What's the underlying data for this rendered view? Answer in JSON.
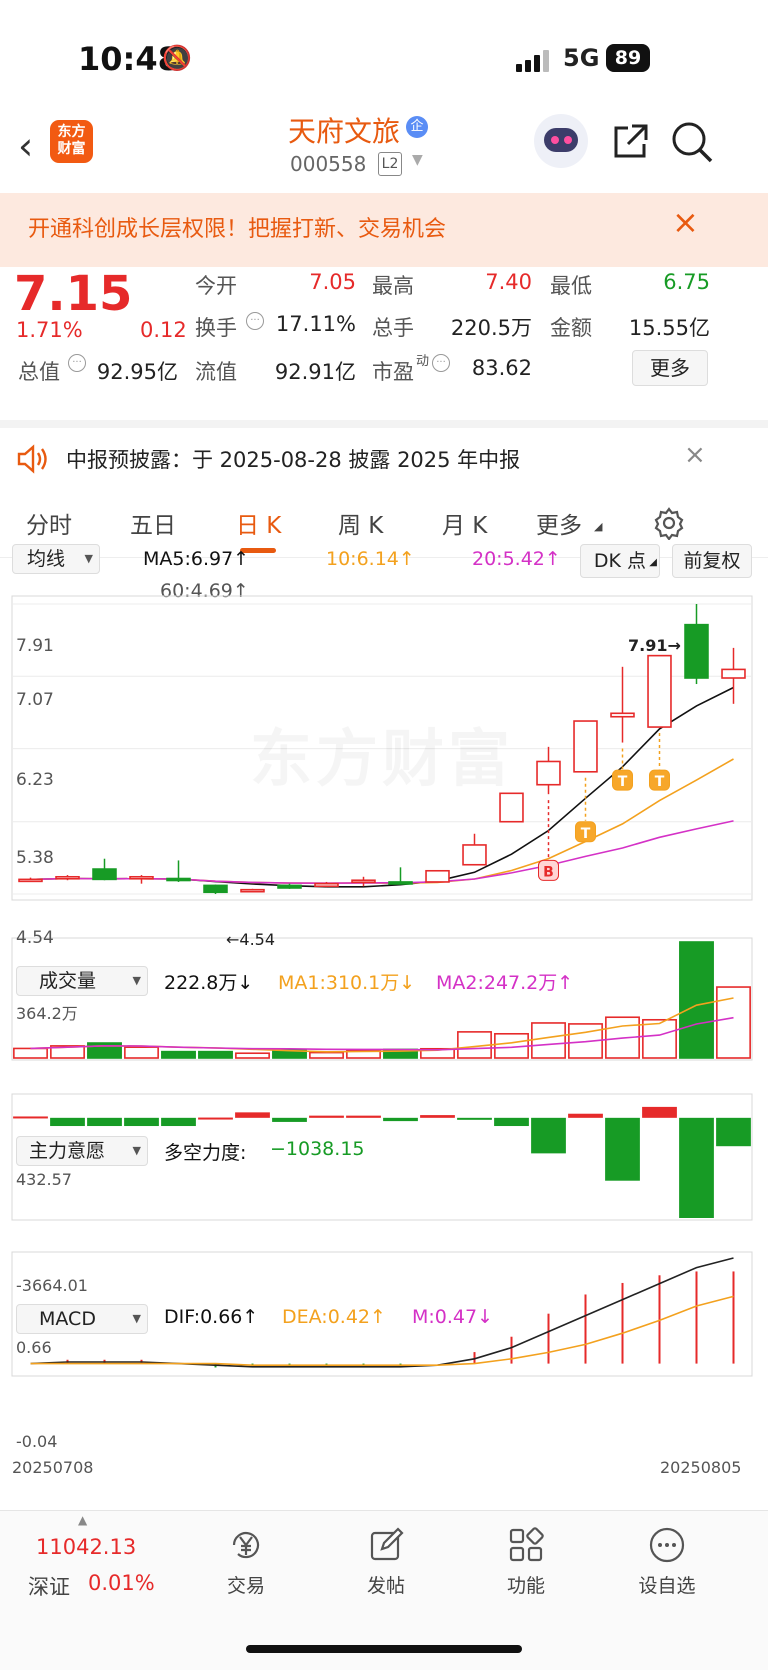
{
  "status": {
    "time": "10:48",
    "network": "5G",
    "battery": "89"
  },
  "nav": {
    "stock_name": "天府文旅",
    "badge": "企",
    "stock_code": "000558",
    "level": "L2",
    "logo_line1": "东方",
    "logo_line2": "财富"
  },
  "banner": {
    "text": "开通科创成长层权限！把握打新、交易机会"
  },
  "quote": {
    "price": "7.15",
    "change_pct": "1.71%",
    "change_amt": "0.12",
    "open_label": "今开",
    "open": "7.05",
    "high_label": "最高",
    "high": "7.40",
    "low_label": "最低",
    "low": "6.75",
    "turnover_label": "换手",
    "turnover": "17.11%",
    "volume_label": "总手",
    "volume": "220.5万",
    "amount_label": "金额",
    "amount": "15.55亿",
    "mktcap_label": "总值",
    "mktcap": "92.95亿",
    "float_label": "流值",
    "float": "92.91亿",
    "pe_label": "市盈",
    "pe_sup": "动",
    "pe": "83.62",
    "more": "更多"
  },
  "notice": {
    "text": "中报预披露：于 2025-08-28 披露 2025 年中报"
  },
  "tabs": [
    {
      "label": "分时"
    },
    {
      "label": "五日"
    },
    {
      "label": "日 K"
    },
    {
      "label": "周 K"
    },
    {
      "label": "月 K"
    },
    {
      "label": "更多"
    }
  ],
  "kline": {
    "indicator": "均线",
    "ma5": "MA5:6.97↑",
    "ma10": "10:6.14↑",
    "ma20": "20:5.42↑",
    "ma60": "60:4.69↑",
    "dk": "DK 点",
    "adjust": "前复权",
    "y_labels": [
      "7.91",
      "7.07",
      "6.23",
      "5.38",
      "4.54"
    ],
    "max_label": "7.91→",
    "min_label": "←4.54",
    "watermark": "东方财富",
    "markers": [
      "B",
      "T",
      "T",
      "T"
    ]
  },
  "volume": {
    "selector": "成交量",
    "value": "222.8万↓",
    "ma1": "MA1:310.1万↓",
    "ma2": "MA2:247.2万↑",
    "y_max": "364.2万"
  },
  "mainforce": {
    "selector": "主力意愿",
    "label": "多空力度:",
    "value": "−1038.15",
    "y_max": "432.57",
    "y_min": "-3664.01"
  },
  "macd": {
    "selector": "MACD",
    "dif": "DIF:0.66↑",
    "dea": "DEA:0.42↑",
    "m": "M:0.47↓",
    "y_max": "0.66",
    "y_min": "-0.04",
    "date_start": "20250708",
    "date_end": "20250805"
  },
  "bottom": {
    "index_value": "11042.13",
    "index_name": "深证",
    "index_pct": "0.01%",
    "items": [
      {
        "label": "交易"
      },
      {
        "label": "发帖"
      },
      {
        "label": "功能"
      },
      {
        "label": "设自选"
      }
    ]
  },
  "chart_data": {
    "type": "candlestick",
    "dates_start": "20250708",
    "dates_end": "20250805",
    "candles": [
      {
        "o": 4.71,
        "c": 4.71,
        "h": 4.73,
        "l": 4.7,
        "up": true
      },
      {
        "o": 4.74,
        "c": 4.73,
        "h": 4.76,
        "l": 4.7,
        "up": true
      },
      {
        "o": 4.83,
        "c": 4.71,
        "h": 4.95,
        "l": 4.7,
        "up": false
      },
      {
        "o": 4.74,
        "c": 4.72,
        "h": 4.76,
        "l": 4.66,
        "up": true
      },
      {
        "o": 4.72,
        "c": 4.7,
        "h": 4.93,
        "l": 4.68,
        "up": false
      },
      {
        "o": 4.64,
        "c": 4.56,
        "h": 4.65,
        "l": 4.54,
        "up": false
      },
      {
        "o": 4.59,
        "c": 4.59,
        "h": 4.6,
        "l": 4.57,
        "up": true
      },
      {
        "o": 4.64,
        "c": 4.61,
        "h": 4.66,
        "l": 4.6,
        "up": false
      },
      {
        "o": 4.63,
        "c": 4.66,
        "h": 4.68,
        "l": 4.62,
        "up": true
      },
      {
        "o": 4.68,
        "c": 4.7,
        "h": 4.74,
        "l": 4.63,
        "up": true
      },
      {
        "o": 4.66,
        "c": 4.68,
        "h": 4.85,
        "l": 4.66,
        "up": false
      },
      {
        "o": 4.68,
        "c": 4.81,
        "h": 4.81,
        "l": 4.68,
        "up": true
      },
      {
        "o": 4.88,
        "c": 5.11,
        "h": 5.24,
        "l": 4.88,
        "up": true
      },
      {
        "o": 5.38,
        "c": 5.71,
        "h": 5.71,
        "l": 5.38,
        "up": true
      },
      {
        "o": 5.81,
        "c": 6.08,
        "h": 6.25,
        "l": 5.7,
        "up": true
      },
      {
        "o": 5.96,
        "c": 6.55,
        "h": 6.55,
        "l": 5.96,
        "up": true
      },
      {
        "o": 6.6,
        "c": 6.64,
        "h": 7.18,
        "l": 6.3,
        "up": true
      },
      {
        "o": 6.48,
        "c": 7.31,
        "h": 7.31,
        "l": 6.48,
        "up": true
      },
      {
        "o": 7.67,
        "c": 7.05,
        "h": 7.91,
        "l": 6.98,
        "up": false
      },
      {
        "o": 7.05,
        "c": 7.15,
        "h": 7.4,
        "l": 6.75,
        "up": true
      }
    ],
    "volume_values": [
      30,
      38,
      47,
      34,
      20,
      20,
      15,
      26,
      17,
      24,
      27,
      29,
      82,
      76,
      110,
      107,
      128,
      120,
      364.2,
      222.8
    ],
    "volume_up": [
      true,
      true,
      false,
      true,
      false,
      false,
      true,
      false,
      true,
      true,
      false,
      true,
      true,
      true,
      true,
      true,
      true,
      true,
      false,
      true
    ],
    "mainforce_values": [
      50,
      -300,
      -300,
      -300,
      -300,
      10,
      200,
      -150,
      80,
      80,
      -120,
      100,
      -20,
      -300,
      -1300,
      150,
      -2300,
      400,
      -3664,
      -1038
    ],
    "macd_dif": [
      0.0,
      0.01,
      0.01,
      0.01,
      0.0,
      -0.01,
      -0.02,
      -0.02,
      -0.02,
      -0.02,
      -0.02,
      -0.01,
      0.03,
      0.1,
      0.2,
      0.3,
      0.4,
      0.5,
      0.6,
      0.66
    ],
    "macd_dea": [
      0.0,
      0.0,
      0.0,
      0.0,
      0.0,
      0.0,
      -0.01,
      -0.01,
      -0.01,
      -0.01,
      -0.01,
      -0.01,
      0.0,
      0.03,
      0.07,
      0.12,
      0.19,
      0.27,
      0.36,
      0.42
    ]
  }
}
